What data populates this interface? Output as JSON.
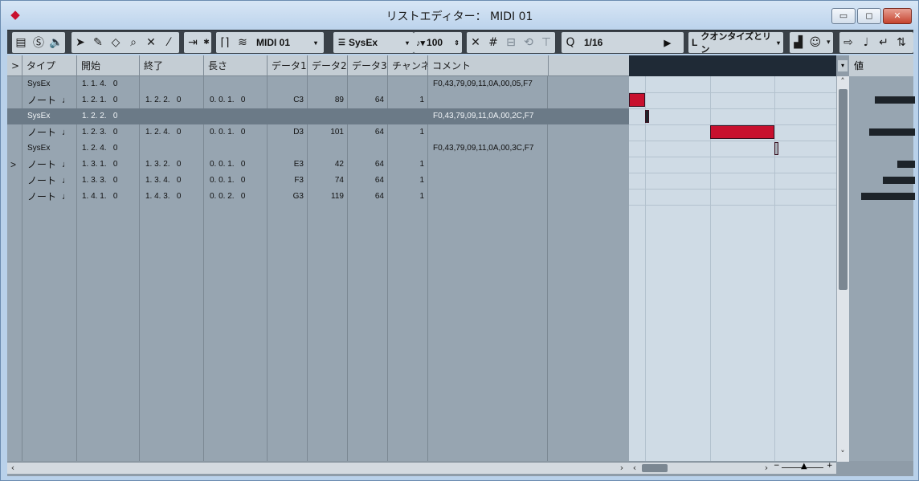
{
  "window": {
    "title": "リストエディター： MIDI 01",
    "min_label": "▭",
    "max_label": "◻",
    "close_label": "✕"
  },
  "toolbar": {
    "track_name": "MIDI 01",
    "event_type": "SysEx",
    "velocity": "100",
    "quantize": "1/16",
    "length_quantize": "クオンタイズとリン"
  },
  "columns": {
    "expand": ">",
    "type": "タイプ",
    "start": "開始",
    "end": "終了",
    "length": "長さ",
    "data1": "データ1",
    "data2": "データ2",
    "data3": "データ3",
    "channel": "チャンネル",
    "comment": "コメント"
  },
  "value_header": "値",
  "rows": [
    {
      "mark": "",
      "type": "SysEx",
      "note": "",
      "start": "1. 1. 4.   0",
      "end": "",
      "length": "",
      "d1": "",
      "d2": "",
      "d3": "",
      "ch": "",
      "comment": "F0,43,79,09,11,0A,00,05,F7"
    },
    {
      "mark": "",
      "type": "ノート",
      "note": "♩",
      "start": "1. 2. 1.   0",
      "end": "1. 2. 2.   0",
      "length": "0. 0. 1.   0",
      "d1": "C3",
      "d2": "89",
      "d3": "64",
      "ch": "1",
      "comment": ""
    },
    {
      "mark": "",
      "type": "SysEx",
      "note": "",
      "start": "1. 2. 2.   0",
      "end": "",
      "length": "",
      "d1": "",
      "d2": "",
      "d3": "",
      "ch": "",
      "comment": "F0,43,79,09,11,0A,00,2C,F7"
    },
    {
      "mark": "",
      "type": "ノート",
      "note": "♩",
      "start": "1. 2. 3.   0",
      "end": "1. 2. 4.   0",
      "length": "0. 0. 1.   0",
      "d1": "D3",
      "d2": "101",
      "d3": "64",
      "ch": "1",
      "comment": ""
    },
    {
      "mark": "",
      "type": "SysEx",
      "note": "",
      "start": "1. 2. 4.   0",
      "end": "",
      "length": "",
      "d1": "",
      "d2": "",
      "d3": "",
      "ch": "",
      "comment": "F0,43,79,09,11,0A,00,3C,F7"
    },
    {
      "mark": ">",
      "type": "ノート",
      "note": "♩",
      "start": "1. 3. 1.   0",
      "end": "1. 3. 2.   0",
      "length": "0. 0. 1.   0",
      "d1": "E3",
      "d2": "42",
      "d3": "64",
      "ch": "1",
      "comment": ""
    },
    {
      "mark": "",
      "type": "ノート",
      "note": "♩",
      "start": "1. 3. 3.   0",
      "end": "1. 3. 4.   0",
      "length": "0. 0. 1.   0",
      "d1": "F3",
      "d2": "74",
      "d3": "64",
      "ch": "1",
      "comment": ""
    },
    {
      "mark": "",
      "type": "ノート",
      "note": "♩",
      "start": "1. 4. 1.   0",
      "end": "1. 4. 3.   0",
      "length": "0. 0. 2.   0",
      "d1": "G3",
      "d2": "119",
      "d3": "64",
      "ch": "1",
      "comment": ""
    }
  ],
  "selected_row": 2,
  "colors": {
    "note_event": "#c8102e",
    "selected_row": "#6b7a87",
    "toolbar_bg": "#3a4148"
  },
  "icons": {
    "app": "cubase-logo-icon",
    "scroll_left": "‹",
    "scroll_right": "›",
    "scroll_up": "˄",
    "scroll_down": "˅"
  }
}
